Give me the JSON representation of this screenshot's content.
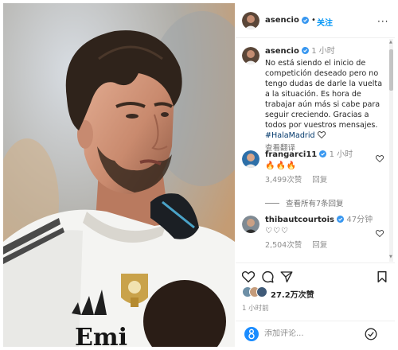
{
  "post": {
    "author": "asencio",
    "follow_label": "关注",
    "dot": "•",
    "more_label": "···",
    "caption": {
      "time": "1 小时",
      "text": "No está siendo el inicio de competición deseado pero no tengo dudas de darle la vuelta a la situación. Es hora de trabajar aún más si cabe para seguir creciendo. Gracias a todos por vuestros mensajes.",
      "hashtag": "#HalaMadrid",
      "translate_label": "查看翻译"
    },
    "comments": [
      {
        "user": "frangarci11",
        "time": "1 小时",
        "text": "🔥🔥🔥",
        "likes": "3,499次赞",
        "reply_label": "回复"
      },
      {
        "user": "thibautcourtois",
        "time": "47分钟",
        "text": "♡♡♡",
        "likes": "2,504次赞",
        "reply_label": "回复"
      }
    ],
    "view_all_replies": "查看所有7条回复",
    "likes_count": "27.2万次赞",
    "posted_time": "1 小时前",
    "add_comment_placeholder": "添加评论..."
  },
  "colors": {
    "accent_blue": "#0095f6",
    "hashtag": "#00376b",
    "muted": "#8e8e8e",
    "real_madrid_gold": "#c9a24a"
  },
  "icons": [
    "verified-badge-icon",
    "heart-icon",
    "comment-icon",
    "share-icon",
    "bookmark-icon",
    "emoji-icon",
    "post-icon",
    "more-icon"
  ]
}
